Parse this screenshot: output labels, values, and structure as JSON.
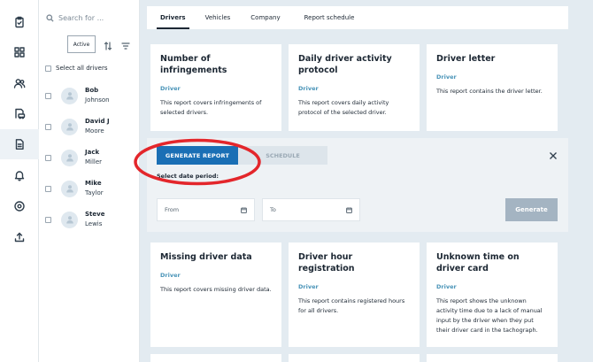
{
  "rail": {
    "items": [
      {
        "icon": "clipboard-icon"
      },
      {
        "icon": "dashboard-grid-icon"
      },
      {
        "icon": "users-icon"
      },
      {
        "icon": "vehicle-document-icon"
      },
      {
        "icon": "reports-document-icon",
        "active": true
      },
      {
        "icon": "bell-icon"
      },
      {
        "icon": "location-pin-icon"
      },
      {
        "icon": "upload-icon"
      }
    ]
  },
  "sidebar": {
    "search_placeholder": "Search for ...",
    "filter_chip": "Active",
    "select_all": "Select all drivers",
    "drivers": [
      {
        "first": "Bob",
        "last": "Johnson"
      },
      {
        "first": "David J",
        "last": "Moore"
      },
      {
        "first": "Jack",
        "last": "Miller"
      },
      {
        "first": "Mike",
        "last": "Taylor"
      },
      {
        "first": "Steve",
        "last": "Lewis"
      }
    ]
  },
  "tabs": [
    {
      "label": "Drivers",
      "active": true
    },
    {
      "label": "Vehicles"
    },
    {
      "label": "Company"
    },
    {
      "label": "Report schedule"
    }
  ],
  "cards_top": [
    {
      "title": "Number of infringements",
      "subject": "Driver",
      "description": "This report covers infringements of selected drivers."
    },
    {
      "title": "Daily driver activity protocol",
      "subject": "Driver",
      "description": "This report covers daily activity protocol of the selected driver."
    },
    {
      "title": "Driver letter",
      "subject": "Driver",
      "description": "This report contains the driver letter."
    }
  ],
  "generate_panel": {
    "generate_report_tab": "GENERATE REPORT",
    "schedule_tab": "SCHEDULE",
    "period_label": "Select date period:",
    "from_placeholder": "From",
    "to_placeholder": "To",
    "generate_button": "Generate"
  },
  "cards_bottom": [
    {
      "title": "Missing driver data",
      "subject": "Driver",
      "description": "This report covers missing driver data."
    },
    {
      "title": "Driver hour registration",
      "subject": "Driver",
      "description": "This report contains registered hours for all drivers."
    },
    {
      "title": "Unknown time on driver card",
      "subject": "Driver",
      "description": "This report shows the unknown activity time due to a lack of manual input by the driver when they put their driver card in the tachograph."
    }
  ],
  "colors": {
    "primary": "#1a6fb5",
    "accent_text": "#4a94b8",
    "annotation": "#e3262b",
    "disabled_button": "#a4b4c2"
  }
}
